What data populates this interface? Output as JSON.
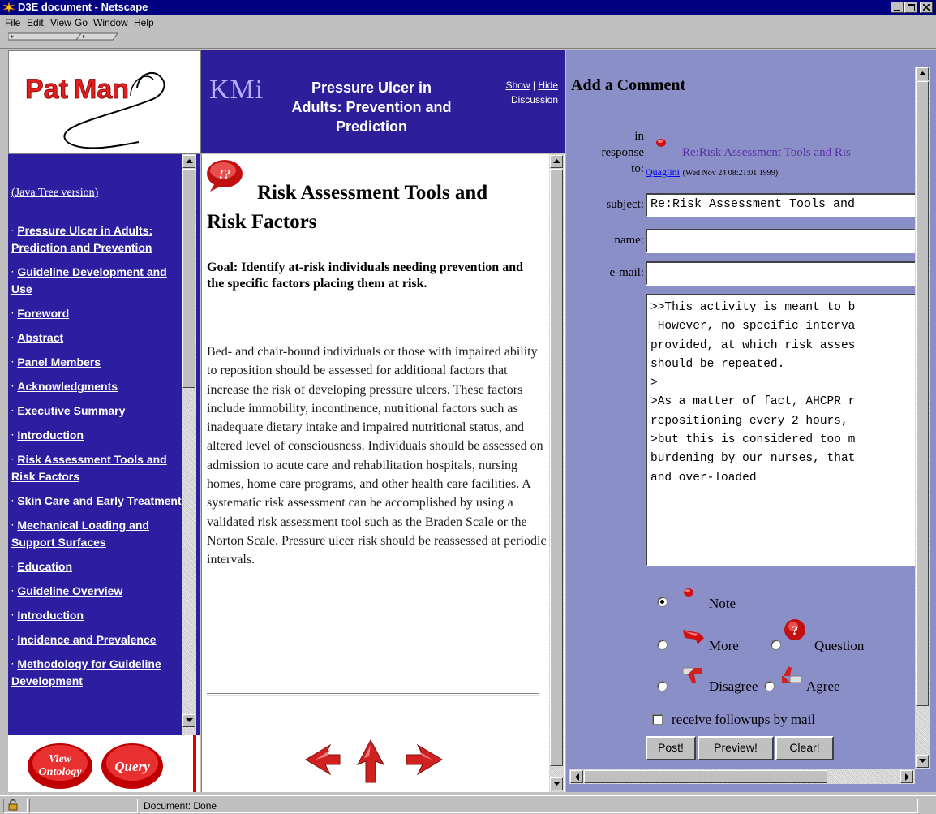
{
  "window": {
    "title": "D3E document - Netscape",
    "controls": [
      "_",
      "□",
      "×"
    ]
  },
  "menu": [
    "File",
    "Edit",
    "View",
    "Go",
    "Window",
    "Help"
  ],
  "logo": {
    "text": "PatMan"
  },
  "header": {
    "kmi": "KMi",
    "title": "Pressure Ulcer in Adults: Prevention and Prediction",
    "show": "Show",
    "sep": "|",
    "hide": "Hide",
    "discussion": "Discussion"
  },
  "nav": {
    "tree_link": "(Java Tree version)",
    "items": [
      "Pressure Ulcer in Adults: Prediction and Prevention",
      "Guideline Development and Use",
      "Foreword",
      "Abstract",
      "Panel Members",
      "Acknowledgments",
      "Executive Summary",
      "Introduction",
      "Risk Assessment Tools and Risk Factors",
      "Skin Care and Early Treatment",
      "Mechanical Loading and Support Surfaces",
      "Education",
      "Guideline Overview",
      "Introduction",
      "Incidence and Prevalence",
      "Methodology for Guideline Development"
    ]
  },
  "buttons": {
    "view_ontology_1": "View",
    "view_ontology_2": "Ontology",
    "query": "Query"
  },
  "content": {
    "title": "Risk Assessment Tools and Risk Factors",
    "goal": "Goal: Identify at-risk individuals needing prevention and the specific factors placing them at risk.",
    "body": "Bed- and chair-bound individuals or those with impaired ability to reposition should be assessed for additional factors that increase the risk of developing pressure ulcers. These factors include immobility, incontinence, nutritional factors such as inadequate dietary intake and impaired nutritional status, and altered level of consciousness. Individuals should be assessed on admission to acute care and rehabilitation hospitals, nursing homes, home care programs, and other health care facilities. A systematic risk assessment can be accomplished by using a validated risk assessment tool such as the Braden Scale or the Norton Scale. Pressure ulcer risk should be reassessed at periodic intervals."
  },
  "comment": {
    "heading": "Add a Comment",
    "in_label": "in",
    "response_label": "response",
    "to_label": "to:",
    "response_link": "Re:Risk Assessment Tools and Ris",
    "author": "Quaglini",
    "date": "(Wed Nov 24 08:21:01 1999)",
    "subject_label": "subject:",
    "subject_value": "Re:Risk Assessment Tools and",
    "name_label": "name:",
    "name_value": "",
    "email_label": "e-mail:",
    "email_value": "",
    "message": ">>This activity is meant to b\n However, no specific interva\nprovided, at which risk asses\nshould be repeated.\n>\n>As a matter of fact, AHCPR r\nrepositioning every 2 hours, \n>but this is considered too m\nburdening by our nurses, that\nand over-loaded",
    "types": {
      "note": "Note",
      "more": "More",
      "question": "Question",
      "disagree": "Disagree",
      "agree": "Agree"
    },
    "selected_type": "Note",
    "followups_label": "receive followups by mail",
    "followups_checked": false,
    "post": "Post!",
    "preview": "Preview!",
    "clear": "Clear!"
  },
  "status": {
    "text": "Document: Done"
  },
  "colors": {
    "nav_bg": "#2c1ea1",
    "header_bg": "#2d1f9a",
    "comment_bg": "#8b8fc8",
    "title_bar": "#000080",
    "link": "#5a2ea8"
  }
}
